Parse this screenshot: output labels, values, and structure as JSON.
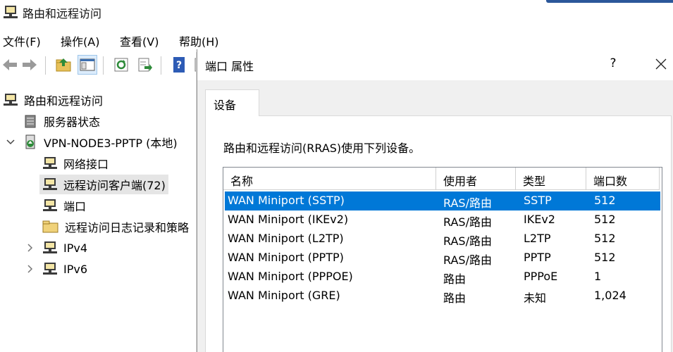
{
  "window": {
    "title": "路由和远程访问"
  },
  "menu": [
    "文件(F)",
    "操作(A)",
    "查看(V)",
    "帮助(H)"
  ],
  "toolbar": [
    "back",
    "forward",
    "up-folder",
    "show-hide-console-tree",
    "refresh",
    "export-list",
    "help",
    "properties"
  ],
  "tree": [
    {
      "label": "路由和远程访问",
      "icon": "server-icon",
      "level": 0,
      "chevron": ""
    },
    {
      "label": "服务器状态",
      "icon": "server-status-icon",
      "level": 1,
      "chevron": ""
    },
    {
      "label": "VPN-NODE3-PPTP (本地)",
      "icon": "server-local-icon",
      "level": 1,
      "chevron": "expanded"
    },
    {
      "label": "网络接口",
      "icon": "network-icon",
      "level": 2,
      "chevron": ""
    },
    {
      "label": "远程访问客户端(72)",
      "icon": "network-icon",
      "level": 2,
      "chevron": "",
      "selected": true
    },
    {
      "label": "端口",
      "icon": "network-icon",
      "level": 2,
      "chevron": ""
    },
    {
      "label": "远程访问日志记录和策略",
      "icon": "folder-icon",
      "level": 2,
      "chevron": ""
    },
    {
      "label": "IPv4",
      "icon": "network-icon",
      "level": 2,
      "chevron": "collapsed"
    },
    {
      "label": "IPv6",
      "icon": "network-icon",
      "level": 2,
      "chevron": "collapsed"
    }
  ],
  "dialog": {
    "title": "端口 属性",
    "help": "?",
    "tab": "设备",
    "description": "路由和远程访问(RRAS)使用下列设备。",
    "columns": [
      "名称",
      "使用者",
      "类型",
      "端口数"
    ],
    "rows": [
      [
        "WAN Miniport (SSTP)",
        "RAS/路由",
        "SSTP",
        "512"
      ],
      [
        "WAN Miniport (IKEv2)",
        "RAS/路由",
        "IKEv2",
        "512"
      ],
      [
        "WAN Miniport (L2TP)",
        "RAS/路由",
        "L2TP",
        "512"
      ],
      [
        "WAN Miniport (PPTP)",
        "RAS/路由",
        "PPTP",
        "512"
      ],
      [
        "WAN Miniport (PPPOE)",
        "路由",
        "PPPoE",
        "1"
      ],
      [
        "WAN Miniport (GRE)",
        "路由",
        "未知",
        "1,024"
      ]
    ],
    "selected_row": 0
  },
  "colors": {
    "selection": "#0078d7",
    "tree_selected": "#e5e5e5",
    "accent": "#2b579a"
  }
}
